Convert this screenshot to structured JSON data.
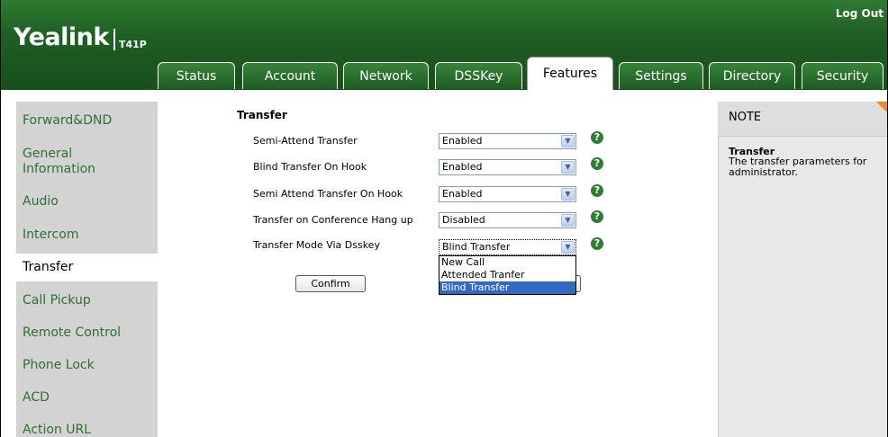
{
  "header": {
    "logo": "Yealink",
    "model": "T41P",
    "logout": "Log Out"
  },
  "tabs": [
    {
      "label": "Status"
    },
    {
      "label": "Account"
    },
    {
      "label": "Network"
    },
    {
      "label": "DSSKey"
    },
    {
      "label": "Features",
      "active": true
    },
    {
      "label": "Settings"
    },
    {
      "label": "Directory"
    },
    {
      "label": "Security"
    }
  ],
  "sidebar": {
    "items": [
      {
        "label": "Forward&DND"
      },
      {
        "label": "General Information"
      },
      {
        "label": "Audio"
      },
      {
        "label": "Intercom"
      },
      {
        "label": "Transfer",
        "active": true
      },
      {
        "label": "Call Pickup"
      },
      {
        "label": "Remote Control"
      },
      {
        "label": "Phone Lock"
      },
      {
        "label": "ACD"
      },
      {
        "label": "Action URL"
      }
    ]
  },
  "main": {
    "section_title": "Transfer",
    "rows": [
      {
        "label": "Semi-Attend Transfer",
        "value": "Enabled"
      },
      {
        "label": "Blind Transfer On Hook",
        "value": "Enabled"
      },
      {
        "label": "Semi Attend Transfer On Hook",
        "value": "Enabled"
      },
      {
        "label": "Transfer on Conference Hang up",
        "value": "Disabled"
      },
      {
        "label": "Transfer Mode Via Dsskey",
        "value": "Blind Transfer"
      }
    ],
    "dropdown_options": [
      "New Call",
      "Attended Tranfer",
      "Blind Transfer"
    ],
    "dropdown_selected": "Blind Transfer",
    "help_icon": "?",
    "confirm_label": "Confirm"
  },
  "note": {
    "title": "NOTE",
    "subtitle": "Transfer",
    "text": "The transfer parameters for administrator."
  },
  "colors": {
    "header_green": "#1f5f24",
    "link_green": "#2f6f33",
    "sidebar_gray": "#d3d3d3",
    "select_highlight": "#316ac5",
    "note_corner": "#f08a24"
  }
}
